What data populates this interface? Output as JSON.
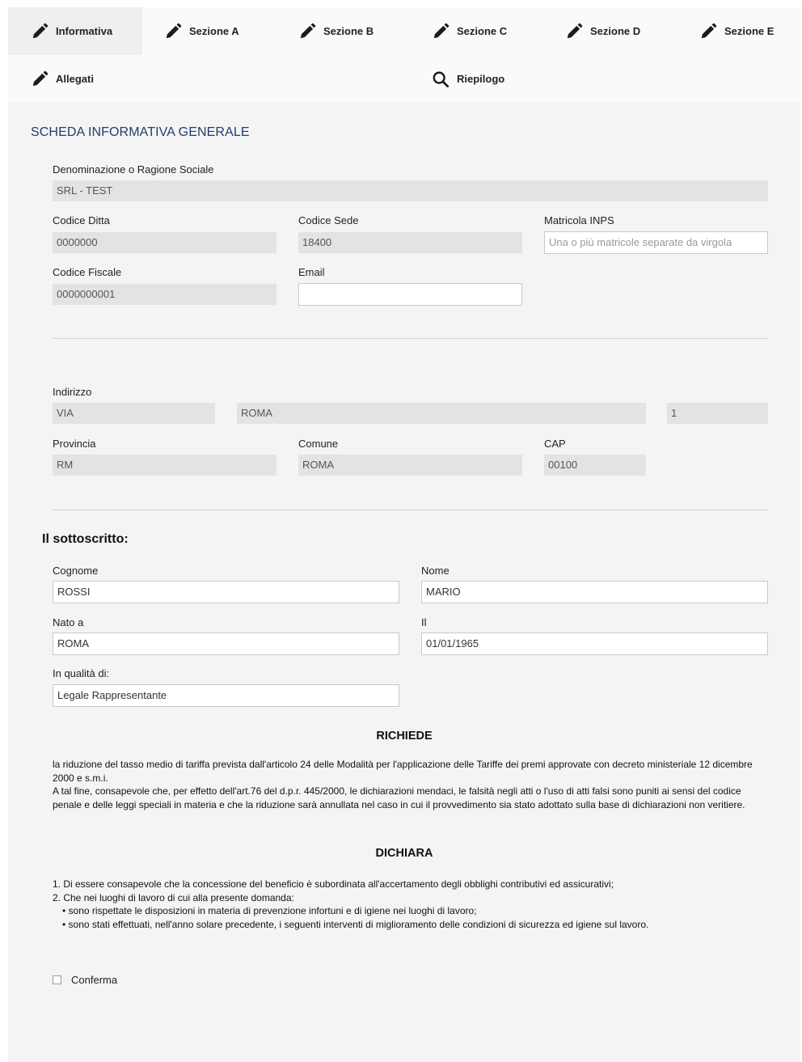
{
  "tabs": [
    {
      "label": "Informativa",
      "icon": "pencil-icon"
    },
    {
      "label": "Sezione A",
      "icon": "pencil-icon"
    },
    {
      "label": "Sezione B",
      "icon": "pencil-icon"
    },
    {
      "label": "Sezione C",
      "icon": "pencil-icon"
    },
    {
      "label": "Sezione D",
      "icon": "pencil-icon"
    },
    {
      "label": "Sezione E",
      "icon": "pencil-icon"
    },
    {
      "label": "Allegati",
      "icon": "pencil-icon"
    },
    {
      "label": "Riepilogo",
      "icon": "search-icon"
    }
  ],
  "active_tab": "Informativa",
  "section_title": "SCHEDA INFORMATIVA GENERALE",
  "company": {
    "denominazione_label": "Denominazione o Ragione Sociale",
    "denominazione_value": "SRL - TEST",
    "codice_ditta_label": "Codice Ditta",
    "codice_ditta_value": "0000000",
    "codice_sede_label": "Codice Sede",
    "codice_sede_value": "18400",
    "matricola_label": "Matricola INPS",
    "matricola_placeholder": "Una o più matricole separate da virgola",
    "codice_fiscale_label": "Codice Fiscale",
    "codice_fiscale_value": "0000000001",
    "email_label": "Email",
    "email_value": ""
  },
  "address": {
    "indirizzo_label": "Indirizzo",
    "via": "VIA",
    "street": "ROMA",
    "number": "1",
    "provincia_label": "Provincia",
    "provincia_value": "RM",
    "comune_label": "Comune",
    "comune_value": "ROMA",
    "cap_label": "CAP",
    "cap_value": "00100"
  },
  "signer": {
    "heading": "Il sottoscritto:",
    "cognome_label": "Cognome",
    "cognome_value": "ROSSI",
    "nome_label": "Nome",
    "nome_value": "MARIO",
    "nato_label": "Nato a",
    "nato_value": "ROMA",
    "il_label": "Il",
    "il_value": "01/01/1965",
    "qualita_label": "In qualità di:",
    "qualita_value": "Legale Rappresentante"
  },
  "richiede": {
    "heading": "RICHIEDE",
    "paragraph1": "la riduzione del tasso medio di tariffa prevista dall'articolo 24 delle Modalità per l'applicazione delle Tariffe dei premi approvate con decreto ministeriale 12 dicembre 2000 e s.m.i.",
    "paragraph2": "A tal fine, consapevole che, per effetto dell'art.76 del d.p.r. 445/2000, le dichiarazioni mendaci, le falsità negli atti o l'uso di atti falsi sono puniti ai sensi del codice penale e delle leggi speciali in materia e che la riduzione sarà annullata nel caso in cui il provvedimento sia stato adottato sulla base di dichiarazioni non veritiere."
  },
  "dichiara": {
    "heading": "DICHIARA",
    "item1": "1. Di essere consapevole che la concessione del beneficio è subordinata all'accertamento degli obblighi contributivi ed assicurativi;",
    "item2": "2. Che nei luoghi di lavoro di cui alla presente domanda:",
    "bullet1": "• sono rispettate le disposizioni in materia di prevenzione infortuni e di igiene nei luoghi di lavoro;",
    "bullet2": "• sono stati effettuati, nell'anno solare precedente, i seguenti interventi di miglioramento delle condizioni di sicurezza ed igiene sul lavoro."
  },
  "confirm_label": "Conferma"
}
